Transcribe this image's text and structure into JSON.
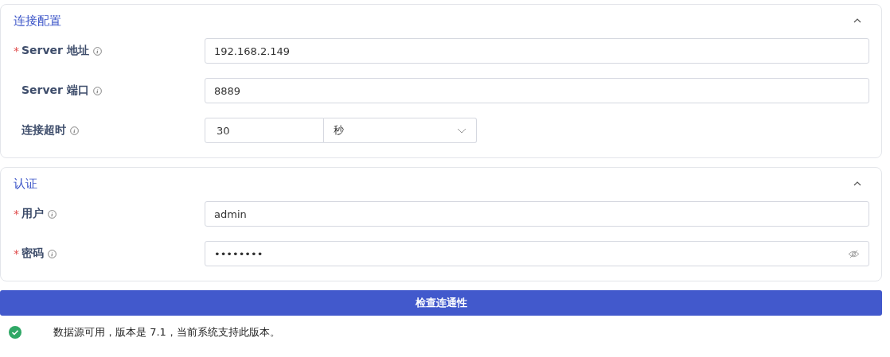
{
  "sections": [
    {
      "title": "连接配置",
      "expanded": true,
      "fields": [
        {
          "kind": "text",
          "label": "Server 地址",
          "required": true,
          "value": "192.168.2.149"
        },
        {
          "kind": "text",
          "label": "Server 端口",
          "required": false,
          "value": "8889"
        },
        {
          "kind": "duration",
          "label": "连接超时",
          "required": false,
          "value": "30",
          "unit": "秒"
        }
      ]
    },
    {
      "title": "认证",
      "expanded": true,
      "fields": [
        {
          "kind": "text",
          "label": "用户",
          "required": true,
          "value": "admin"
        },
        {
          "kind": "password",
          "label": "密码",
          "required": true,
          "value": "••••••••"
        }
      ]
    }
  ],
  "required_mark": "*",
  "check_button": "检查连通性",
  "result": {
    "ok": true,
    "message": "数据源可用，版本是 7.1，当前系统支持此版本。"
  }
}
